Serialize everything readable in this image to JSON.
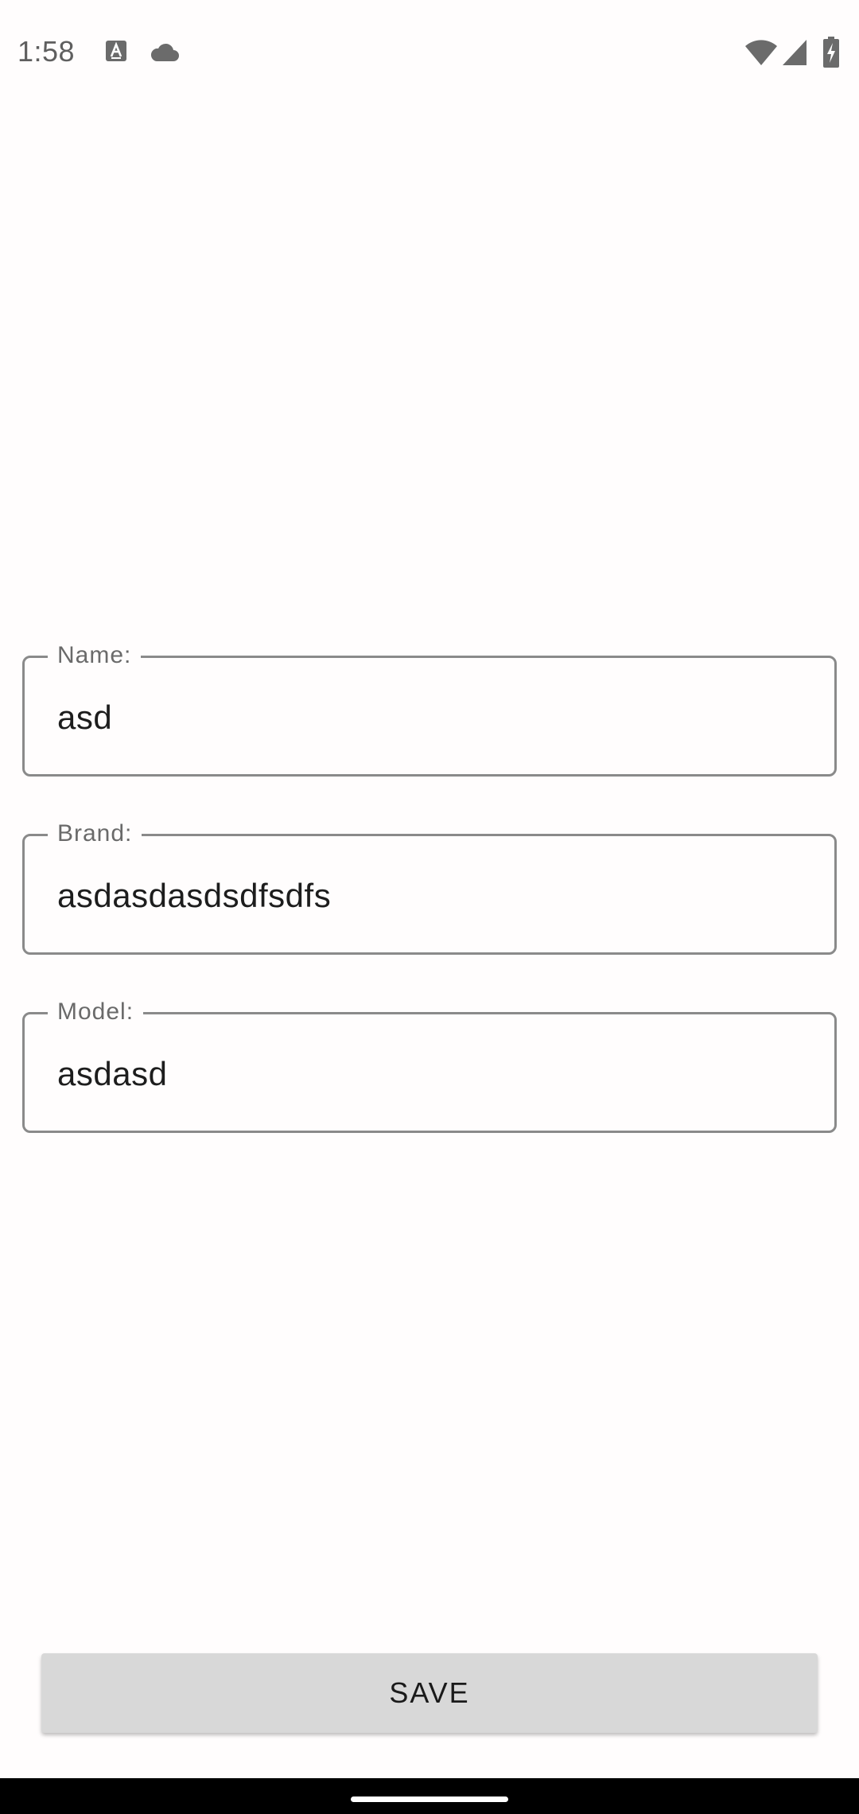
{
  "status_bar": {
    "time": "1:58",
    "icons": [
      "text-format-icon",
      "cloud-icon",
      "wifi-icon",
      "cell-signal-icon",
      "battery-charging-icon"
    ]
  },
  "form": {
    "fields": [
      {
        "label": "Name:",
        "value": "asd"
      },
      {
        "label": "Brand:",
        "value": "asdasdasdsdfsdfs"
      },
      {
        "label": "Model:",
        "value": "asdasd"
      }
    ]
  },
  "actions": {
    "save_label": "SAVE"
  },
  "colors": {
    "background": "#fffdfd",
    "field_border": "#8a8a8a",
    "button_background": "#d8d8d8",
    "nav_bar": "#000000"
  }
}
